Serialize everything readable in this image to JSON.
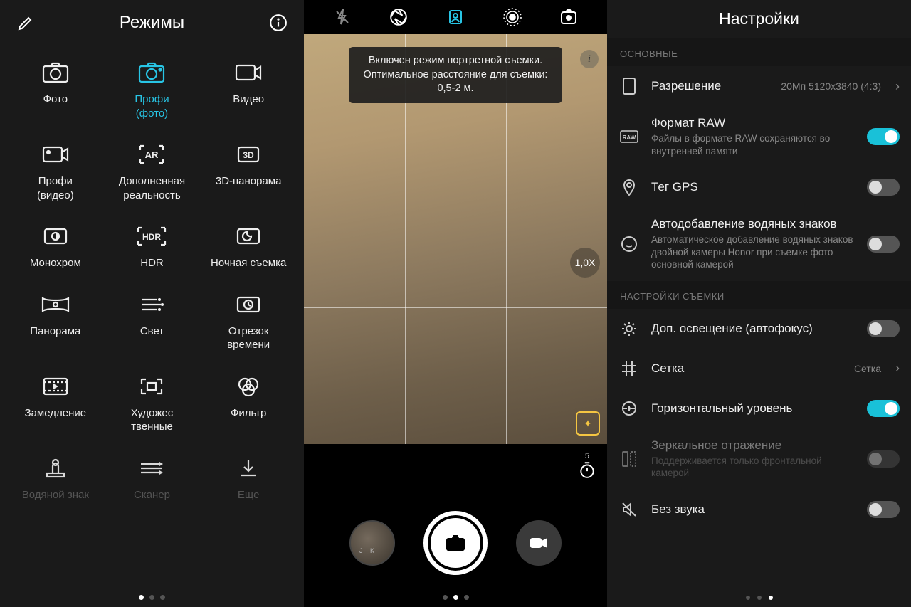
{
  "modes": {
    "title": "Режимы",
    "items": [
      {
        "label": "Фото"
      },
      {
        "label": "Профи\n(фото)",
        "active": true
      },
      {
        "label": "Видео"
      },
      {
        "label": "Профи\n(видео)"
      },
      {
        "label": "Дополненная\nреальность"
      },
      {
        "label": "3D-панорама"
      },
      {
        "label": "Монохром"
      },
      {
        "label": "HDR"
      },
      {
        "label": "Ночная съемка"
      },
      {
        "label": "Панорама"
      },
      {
        "label": "Свет"
      },
      {
        "label": "Отрезок\nвремени"
      },
      {
        "label": "Замедление"
      },
      {
        "label": "Художес\nтвенные"
      },
      {
        "label": "Фильтр"
      },
      {
        "label": "Водяной знак"
      },
      {
        "label": "Сканер"
      },
      {
        "label": "Еще"
      }
    ]
  },
  "viewfinder": {
    "toast": "Включен режим портретной съемки. Оптимальное расстояние для съемки: 0,5-2 м.",
    "zoom": "1,0X",
    "timer": "5"
  },
  "settings": {
    "title": "Настройки",
    "section1": "ОСНОВНЫЕ",
    "section2": "НАСТРОЙКИ СЪЕМКИ",
    "rows": {
      "resolution": {
        "title": "Разрешение",
        "value": "20Мп 5120x3840 (4:3)"
      },
      "raw": {
        "title": "Формат RAW",
        "sub": "Файлы в формате RAW сохраняются во внутренней памяти"
      },
      "gps": {
        "title": "Тег GPS"
      },
      "watermark": {
        "title": "Автодобавление водяных знаков",
        "sub": "Автоматическое добавление водяных знаков двойной камеры Honor при съемке фото основной камерой"
      },
      "focus": {
        "title": "Доп. освещение (автофокус)"
      },
      "grid": {
        "title": "Сетка",
        "value": "Сетка"
      },
      "level": {
        "title": "Горизонтальный уровень"
      },
      "mirror": {
        "title": "Зеркальное отражение",
        "sub": "Поддерживается только фронтальной камерой"
      },
      "mute": {
        "title": "Без звука"
      }
    }
  }
}
